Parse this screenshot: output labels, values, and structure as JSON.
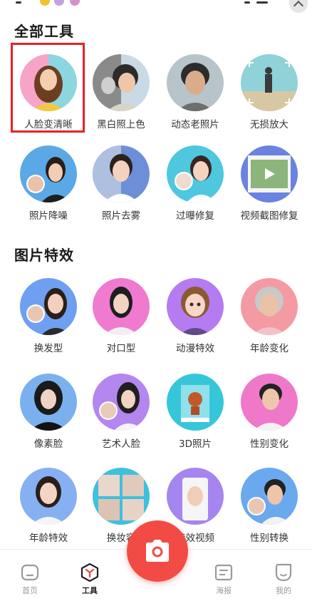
{
  "sections": [
    {
      "title": "全部工具",
      "tools": [
        {
          "label": "人脸变清晰",
          "icon": "face-enhance-avatar",
          "bg": "#f6a4c8",
          "highlighted": true
        },
        {
          "label": "黑白照上色",
          "icon": "colorize-photo-avatar",
          "bg": "#c9d9e6"
        },
        {
          "label": "动态老照片",
          "icon": "animate-old-photo-avatar",
          "bg": "#b7c4c9"
        },
        {
          "label": "无损放大",
          "icon": "lossless-upscale-avatar",
          "bg": "#8fd2d8"
        },
        {
          "label": "照片降噪",
          "icon": "photo-denoise-avatar",
          "bg": "#5aa9e6"
        },
        {
          "label": "照片去雾",
          "icon": "photo-dehaze-avatar",
          "bg": "#6c8fd8"
        },
        {
          "label": "过曝修复",
          "icon": "overexposure-fix-avatar",
          "bg": "#4fc7df"
        },
        {
          "label": "视频截图修复",
          "icon": "video-frame-fix-avatar",
          "bg": "#6a82e0"
        }
      ]
    },
    {
      "title": "图片特效",
      "tools": [
        {
          "label": "换发型",
          "icon": "hairstyle-swap-avatar",
          "bg": "#6f9ff0"
        },
        {
          "label": "对口型",
          "icon": "lip-sync-avatar",
          "bg": "#f07ad0"
        },
        {
          "label": "动漫特效",
          "icon": "anime-effect-avatar",
          "bg": "#b57cf2"
        },
        {
          "label": "年龄变化",
          "icon": "age-change-avatar",
          "bg": "#f49aa3"
        },
        {
          "label": "像素脸",
          "icon": "pixel-face-avatar",
          "bg": "#7ab0ee"
        },
        {
          "label": "艺术人脸",
          "icon": "art-face-avatar",
          "bg": "#b486ef"
        },
        {
          "label": "3D照片",
          "icon": "3d-photo-avatar",
          "bg": "#36c6da"
        },
        {
          "label": "性别变化",
          "icon": "gender-change-avatar",
          "bg": "#ef78c8"
        },
        {
          "label": "年龄特效",
          "icon": "age-effect-avatar",
          "bg": "#86b0f2"
        },
        {
          "label": "换妆容",
          "icon": "makeup-swap-avatar",
          "bg": "#3fc0dc"
        },
        {
          "label": "特效视频",
          "icon": "effect-video-avatar",
          "bg": "#a585ef"
        },
        {
          "label": "性别转换",
          "icon": "gender-swap-avatar",
          "bg": "#6aa9ee"
        }
      ]
    }
  ],
  "tabbar": {
    "tabs": [
      {
        "label": "首页",
        "icon": "home-icon",
        "active": false
      },
      {
        "label": "工具",
        "icon": "tools-icon",
        "active": true
      },
      {
        "label": "海报",
        "icon": "poster-icon",
        "active": false
      },
      {
        "label": "我的",
        "icon": "profile-icon",
        "active": false
      }
    ]
  },
  "camera_button": {
    "icon": "camera-icon",
    "color": "#f24b45"
  }
}
